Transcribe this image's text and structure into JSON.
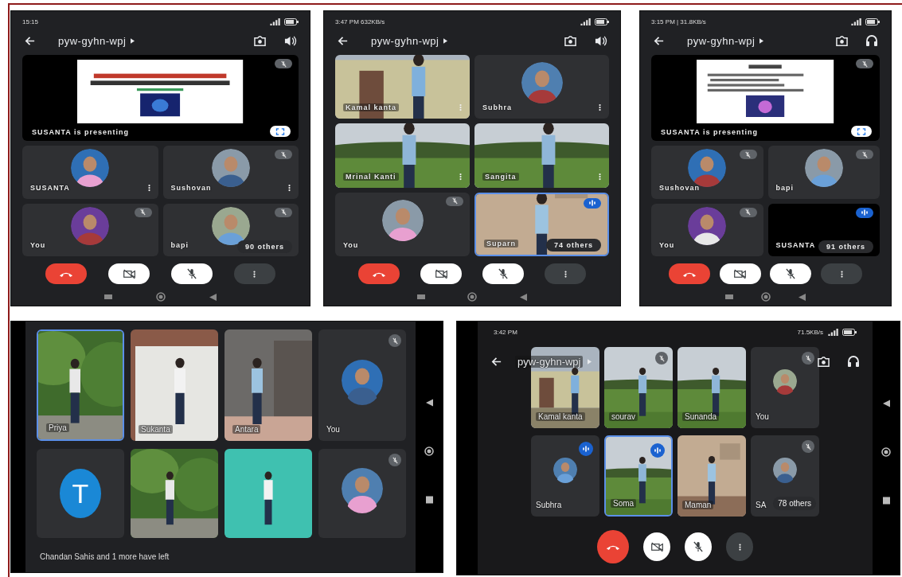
{
  "screens": [
    {
      "kind": "portrait",
      "status": {
        "left": "15:15"
      },
      "header": {
        "title": "pyw-gyhn-wpj",
        "audio": {
          "kind": "speaker"
        }
      },
      "presentation": {
        "caption": "SUSANTA is presenting",
        "muted": true
      },
      "tiles": [
        {
          "name": "SUSANTA",
          "kind": "avatar",
          "muted": false,
          "speaking": false,
          "selected": false,
          "menu": true
        },
        {
          "name": "Sushovan",
          "kind": "avatar",
          "muted": true,
          "speaking": false,
          "selected": false,
          "menu": true
        },
        {
          "name": "You",
          "kind": "avatar",
          "muted": true,
          "speaking": false,
          "selected": false,
          "menu": false
        },
        {
          "name": "bapi",
          "kind": "avatar",
          "muted": true,
          "speaking": false,
          "selected": false,
          "menu": false,
          "others": "90 others"
        }
      ],
      "controls": [
        {
          "kind": "hangup"
        },
        {
          "kind": "camera",
          "on": false
        },
        {
          "kind": "mic",
          "on": false
        },
        {
          "kind": "more"
        }
      ]
    },
    {
      "kind": "portrait",
      "status": {
        "left": "3:47 PM 632KB/s"
      },
      "header": {
        "title": "pyw-gyhn-wpj",
        "audio": {
          "kind": "speaker"
        }
      },
      "tiles": [
        {
          "name": "Kamal kanta",
          "kind": "video",
          "muted": false,
          "speaking": false,
          "selected": false,
          "menu": true
        },
        {
          "name": "Subhra",
          "kind": "avatar",
          "muted": false,
          "speaking": false,
          "selected": false,
          "menu": true
        },
        {
          "name": "Mrinal Kanti",
          "kind": "video",
          "muted": false,
          "speaking": false,
          "selected": false,
          "menu": true
        },
        {
          "name": "Sangita",
          "kind": "video",
          "muted": false,
          "speaking": false,
          "selected": false,
          "menu": true
        },
        {
          "name": "You",
          "kind": "avatar",
          "muted": true,
          "speaking": false,
          "selected": false,
          "menu": false
        },
        {
          "name": "Suparn",
          "kind": "video",
          "muted": false,
          "speaking": true,
          "selected": true,
          "menu": false,
          "others": "74 others"
        }
      ],
      "controls": [
        {
          "kind": "hangup"
        },
        {
          "kind": "camera",
          "on": false
        },
        {
          "kind": "mic",
          "on": false
        },
        {
          "kind": "more"
        }
      ]
    },
    {
      "kind": "portrait",
      "status": {
        "left": "3:15 PM | 31.8KB/s"
      },
      "header": {
        "title": "pyw-gyhn-wpj",
        "audio": {
          "kind": "headphones"
        }
      },
      "presentation": {
        "caption": "SUSANTA is presenting",
        "muted": true
      },
      "tiles": [
        {
          "name": "Sushovan",
          "kind": "avatar",
          "muted": true,
          "speaking": false,
          "selected": false,
          "menu": false
        },
        {
          "name": "bapi",
          "kind": "avatar",
          "muted": true,
          "speaking": false,
          "selected": false,
          "menu": false
        },
        {
          "name": "You",
          "kind": "avatar",
          "muted": true,
          "speaking": false,
          "selected": false,
          "menu": false
        },
        {
          "name": "SUSANTA",
          "kind": "blank",
          "muted": false,
          "speaking": true,
          "selected": false,
          "menu": false,
          "others": "91 others"
        }
      ],
      "controls": [
        {
          "kind": "hangup"
        },
        {
          "kind": "camera",
          "on": false
        },
        {
          "kind": "mic",
          "on": false
        },
        {
          "kind": "more"
        }
      ]
    },
    {
      "kind": "landscape",
      "tiles": [
        {
          "name": "Priya",
          "kind": "video",
          "muted": false,
          "speaking": false,
          "selected": true,
          "menu": false
        },
        {
          "name": "Sukanta",
          "kind": "video",
          "muted": false,
          "speaking": false,
          "selected": false,
          "menu": false
        },
        {
          "name": "Antara",
          "kind": "video",
          "muted": false,
          "speaking": false,
          "selected": false,
          "menu": false
        },
        {
          "name": "You",
          "kind": "avatar",
          "muted": true,
          "speaking": false,
          "selected": false,
          "menu": false
        },
        {
          "kind": "letter",
          "letter": "T",
          "muted": false,
          "speaking": false,
          "selected": false,
          "menu": false
        },
        {
          "kind": "video",
          "muted": false,
          "speaking": false,
          "selected": false,
          "menu": false
        },
        {
          "kind": "video",
          "muted": false,
          "speaking": false,
          "selected": false,
          "menu": false
        },
        {
          "kind": "avatar",
          "muted": true,
          "speaking": false,
          "selected": false,
          "menu": false
        }
      ],
      "toast": "Chandan Sahis and 1 more have left"
    },
    {
      "kind": "landscape",
      "status": {
        "left": "3:42 PM",
        "right": "71.5KB/s"
      },
      "header": {
        "title": "pyw-gyhn-wpj",
        "audio": {
          "kind": "headphones"
        }
      },
      "tiles": [
        {
          "name": "Kamal kanta",
          "kind": "video",
          "muted": false,
          "speaking": false,
          "selected": false,
          "menu": false
        },
        {
          "name": "sourav",
          "kind": "video",
          "muted": true,
          "speaking": false,
          "selected": false,
          "menu": false
        },
        {
          "name": "Sunanda",
          "kind": "video",
          "muted": false,
          "speaking": false,
          "selected": false,
          "menu": false
        },
        {
          "name": "You",
          "kind": "avatar",
          "muted": true,
          "speaking": false,
          "selected": false,
          "menu": false
        },
        {
          "name": "Subhra",
          "kind": "avatar",
          "muted": false,
          "speaking": true,
          "selected": false,
          "menu": false
        },
        {
          "name": "Soma",
          "kind": "video",
          "muted": false,
          "speaking": true,
          "selected": true,
          "menu": false
        },
        {
          "name": "Maman",
          "kind": "video",
          "muted": false,
          "speaking": false,
          "selected": false,
          "menu": false
        },
        {
          "name": "SA",
          "kind": "avatar",
          "muted": true,
          "speaking": false,
          "selected": false,
          "menu": false,
          "others": "78 others"
        }
      ],
      "controls": [
        {
          "kind": "hangup"
        },
        {
          "kind": "camera",
          "on": false
        },
        {
          "kind": "mic",
          "on": false
        },
        {
          "kind": "more"
        }
      ]
    }
  ]
}
